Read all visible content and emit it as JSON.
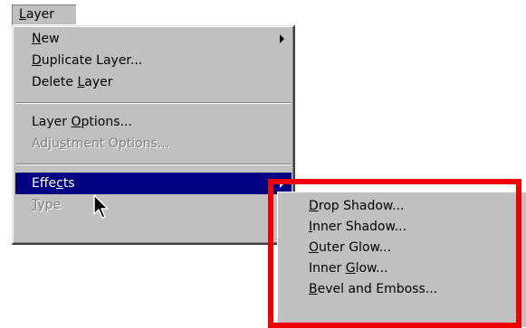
{
  "menubar": {
    "label": "Layer",
    "mnemonic_index": 0
  },
  "menu": {
    "items": [
      {
        "label": "New",
        "mnemonic": 0,
        "has_submenu": true,
        "disabled": false,
        "selected": false
      },
      {
        "label": "Duplicate Layer...",
        "mnemonic": 0,
        "has_submenu": false,
        "disabled": false,
        "selected": false
      },
      {
        "label": "Delete Layer",
        "mnemonic": 7,
        "has_submenu": false,
        "disabled": false,
        "selected": false
      },
      {
        "label": "Layer Options...",
        "mnemonic": 6,
        "has_submenu": false,
        "disabled": false,
        "selected": false
      },
      {
        "label": "Adjustment Options...",
        "mnemonic": 4,
        "has_submenu": false,
        "disabled": true,
        "selected": false
      },
      {
        "label": "Effects",
        "mnemonic": 4,
        "has_submenu": true,
        "disabled": false,
        "selected": true
      },
      {
        "label": "Type",
        "mnemonic": 0,
        "has_submenu": true,
        "disabled": true,
        "selected": false
      }
    ]
  },
  "submenu": {
    "items": [
      {
        "label": "Drop Shadow...",
        "mnemonic": 0
      },
      {
        "label": "Inner Shadow...",
        "mnemonic": 0
      },
      {
        "label": "Outer Glow...",
        "mnemonic": 0
      },
      {
        "label": "Inner Glow...",
        "mnemonic": 6
      },
      {
        "label": "Bevel and Emboss...",
        "mnemonic": 0
      }
    ]
  },
  "colors": {
    "menu_bg": "#c0c0c0",
    "selection": "#000080",
    "highlight_box": "#ee0000",
    "disabled_text": "#808080"
  }
}
